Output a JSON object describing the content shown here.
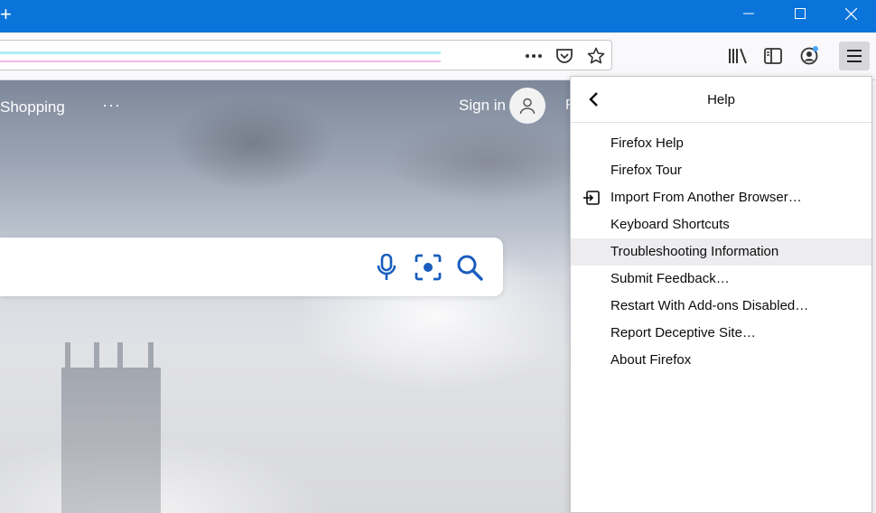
{
  "window": {
    "new_tab_glyph": "+",
    "controls": [
      "minimize-icon",
      "maximize-icon",
      "close-icon"
    ],
    "accent_color": "#0a74da"
  },
  "toolbar": {
    "url_value": "",
    "icons": [
      "page-actions-icon",
      "pocket-icon",
      "bookmark-star-icon",
      "library-icon",
      "sidebar-icon",
      "account-icon",
      "hamburger-menu-icon"
    ]
  },
  "page": {
    "nav_shopping": "Shopping",
    "nav_more": "···",
    "sign_in": "Sign in",
    "cut_letter": "R",
    "search_icons": [
      "microphone-icon",
      "visual-search-icon",
      "search-icon"
    ]
  },
  "help_panel": {
    "title": "Help",
    "items": [
      {
        "label": "Firefox Help",
        "icon": ""
      },
      {
        "label": "Firefox Tour",
        "icon": ""
      },
      {
        "label": "Import From Another Browser…",
        "icon": "import-icon"
      },
      {
        "label": "Keyboard Shortcuts",
        "icon": ""
      },
      {
        "label": "Troubleshooting Information",
        "icon": "",
        "highlighted": true
      },
      {
        "label": "Submit Feedback…",
        "icon": ""
      },
      {
        "label": "Restart With Add-ons Disabled…",
        "icon": ""
      },
      {
        "label": "Report Deceptive Site…",
        "icon": ""
      },
      {
        "label": "About Firefox",
        "icon": ""
      }
    ]
  }
}
